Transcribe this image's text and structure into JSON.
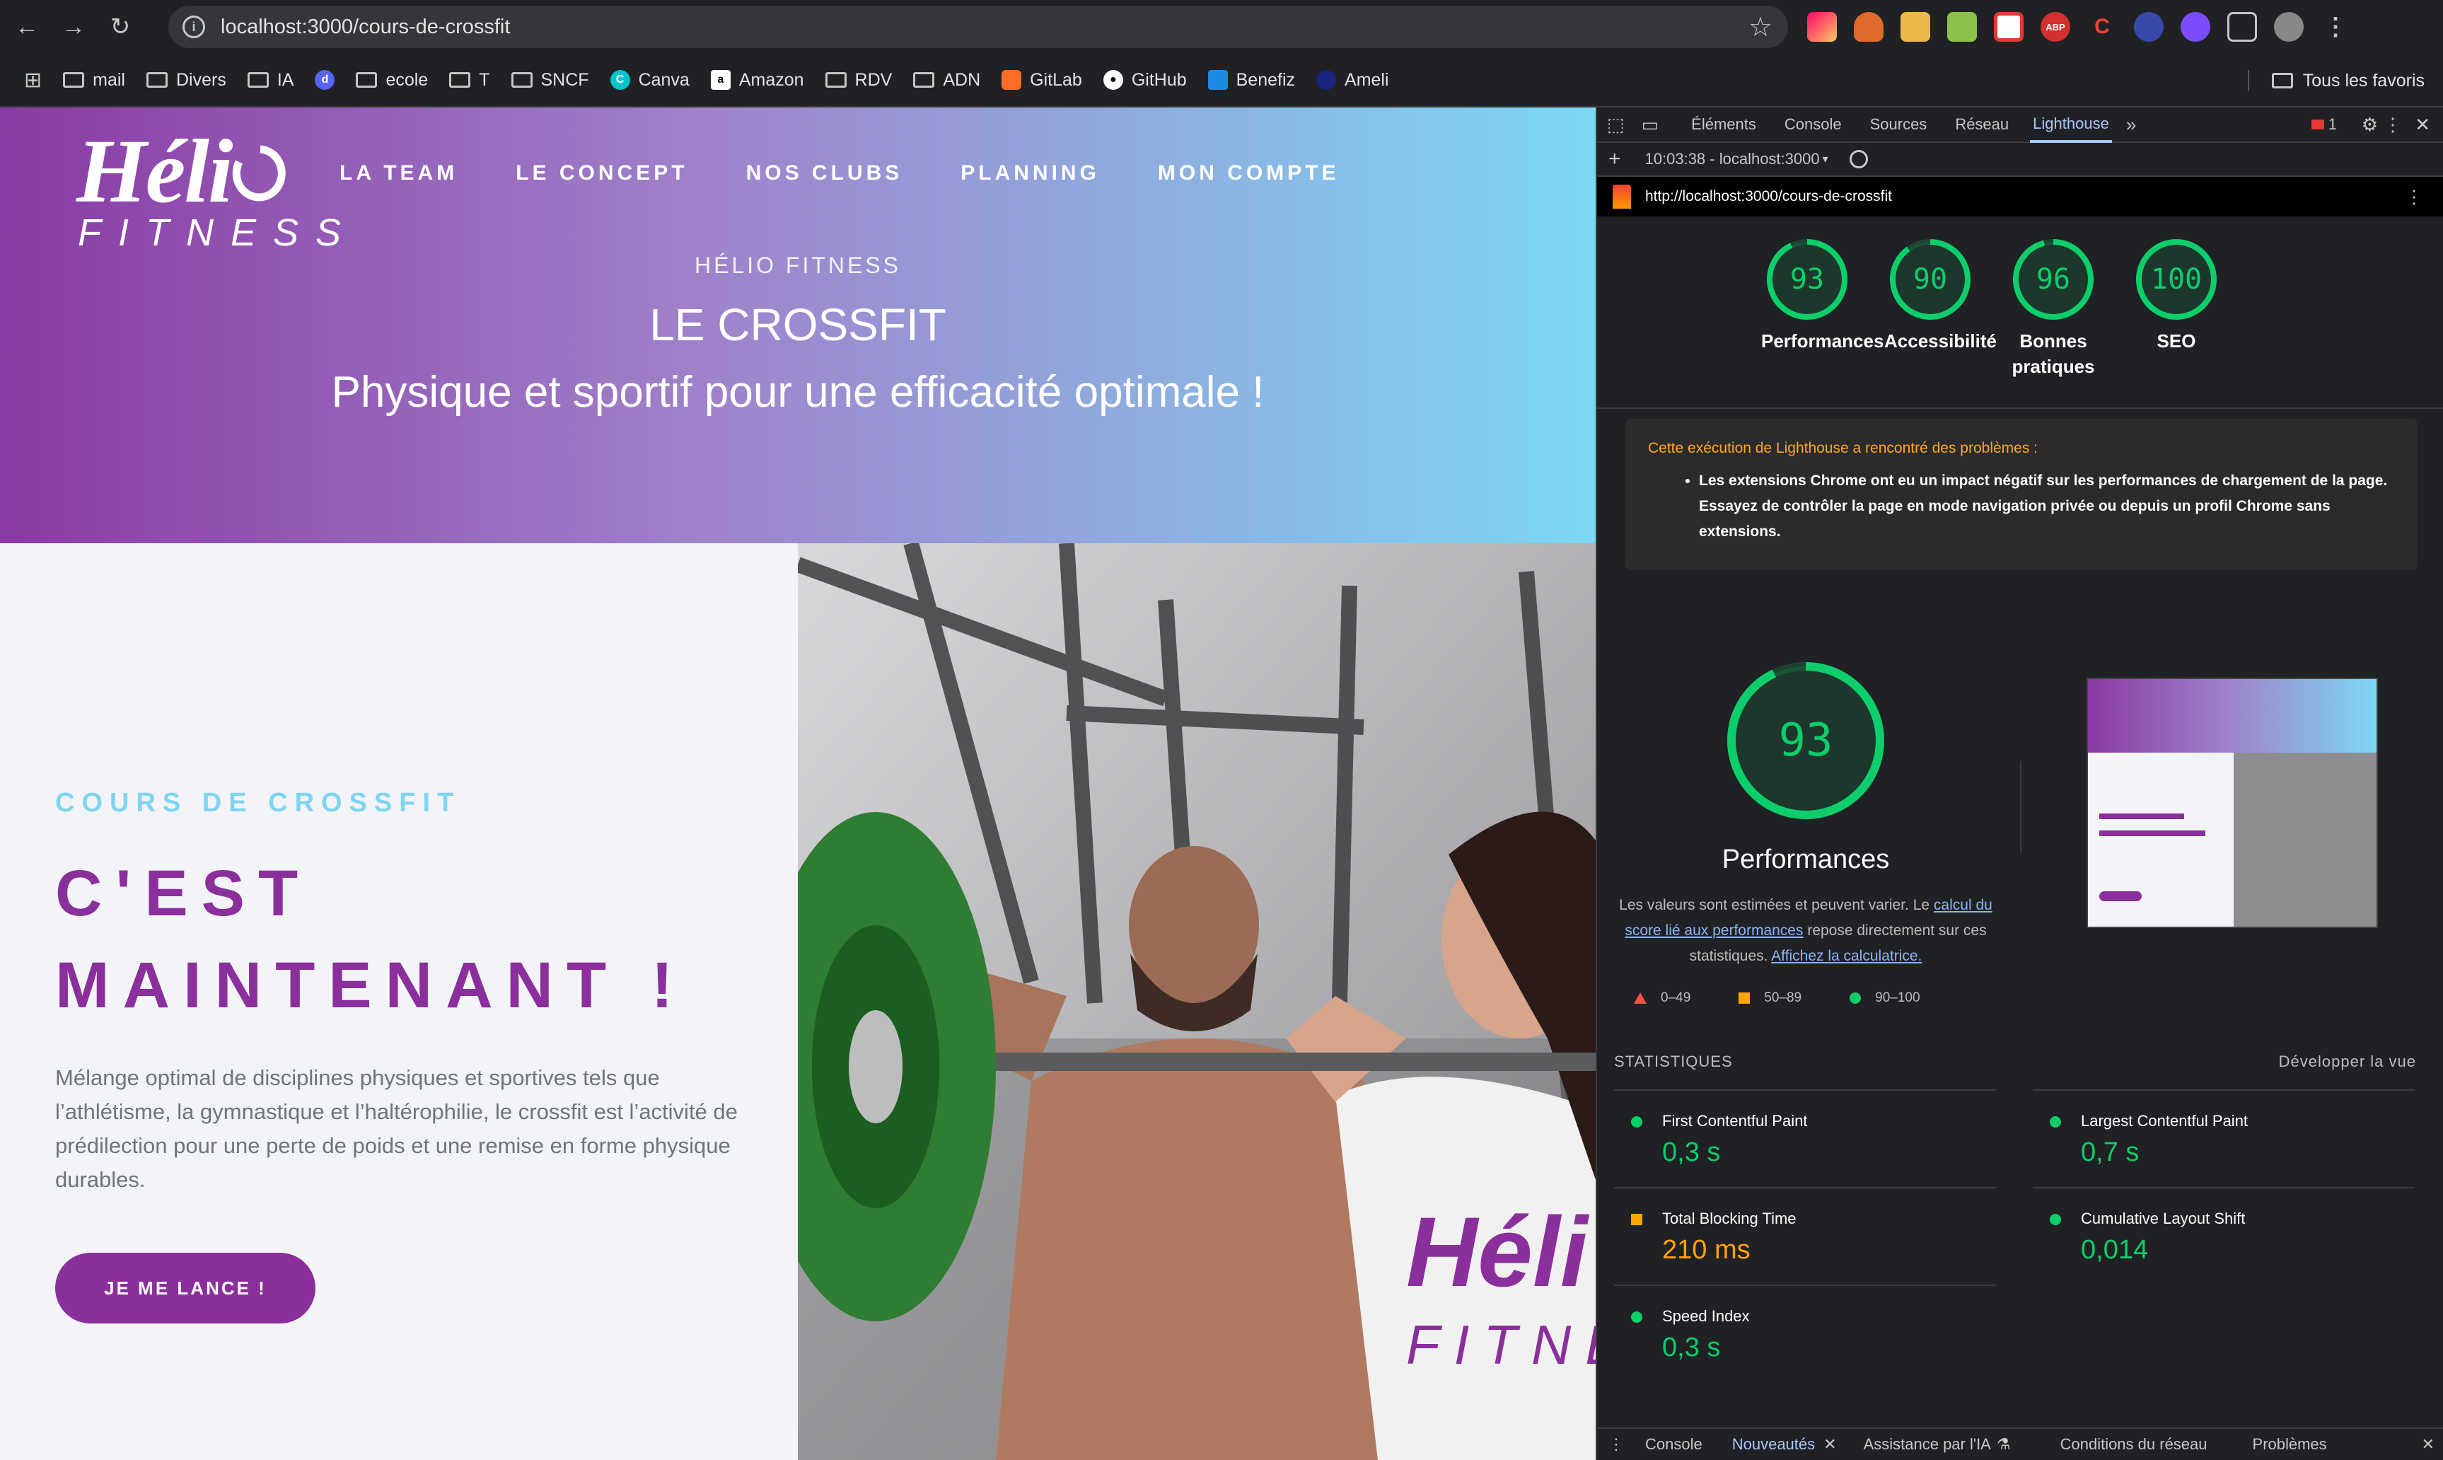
{
  "browser": {
    "url": "localhost:3000/cours-de-crossfit",
    "bookmarks": [
      "mail",
      "Divers",
      "IA",
      "ecole",
      "T",
      "SNCF",
      "Canva",
      "Amazon",
      "RDV",
      "ADN",
      "GitLab",
      "GitHub",
      "Benefiz",
      "Ameli"
    ],
    "all_favorites": "Tous les favoris"
  },
  "site": {
    "logo_top": "Héli",
    "logo_bottom": "FITNESS",
    "nav": [
      "LA TEAM",
      "LE CONCEPT",
      "NOS CLUBS",
      "PLANNING",
      "MON COMPTE"
    ],
    "kicker": "HÉLIO FITNESS",
    "title": "LE CROSSFIT",
    "subtitle": "Physique et sportif pour une efficacité optimale !",
    "eyebrow": "COURS DE CROSSFIT",
    "headline": "C'EST MAINTENANT !",
    "paragraph": "Mélange optimal de disciplines physiques et sportives tels que l’athlétisme, la gymnastique et l’haltérophilie, le crossfit est l’activité de prédilection pour une perte de poids et une remise en forme physique durables.",
    "cta": "JE ME LANCE !",
    "photo_shirt_text": "Héli",
    "photo_shirt_text2": "FITNE"
  },
  "devtools": {
    "tabs": [
      "Éléments",
      "Console",
      "Sources",
      "Réseau",
      "Lighthouse"
    ],
    "active_tab": "Lighthouse",
    "issues_count": "1",
    "report_time": "10:03:38 - localhost:3000",
    "report_url": "http://localhost:3000/cours-de-crossfit",
    "scores": [
      {
        "label": "Performances",
        "value": 93
      },
      {
        "label": "Accessibilité",
        "value": 90
      },
      {
        "label": "Bonnes pratiques",
        "value": 96
      },
      {
        "label": "SEO",
        "value": 100
      }
    ],
    "warning_title": "Cette exécution de Lighthouse a rencontré des problèmes :",
    "warning_item": "Les extensions Chrome ont eu un impact négatif sur les performances de chargement de la page. Essayez de contrôler la page en mode navigation privée ou depuis un profil Chrome sans extensions.",
    "perf_score": 93,
    "perf_title": "Performances",
    "perf_desc_1": "Les valeurs sont estimées et peuvent varier. Le ",
    "perf_desc_link1": "calcul du score lié aux performances",
    "perf_desc_2": " repose directement sur ces statistiques. ",
    "perf_desc_link2": "Affichez la calculatrice.",
    "legend": [
      "0–49",
      "50–89",
      "90–100"
    ],
    "stats_title": "STATISTIQUES",
    "expand": "Développer la vue",
    "metrics": [
      {
        "name": "First Contentful Paint",
        "value": "0,3 s",
        "status": "good"
      },
      {
        "name": "Largest Contentful Paint",
        "value": "0,7 s",
        "status": "good"
      },
      {
        "name": "Total Blocking Time",
        "value": "210 ms",
        "status": "average"
      },
      {
        "name": "Cumulative Layout Shift",
        "value": "0,014",
        "status": "good"
      },
      {
        "name": "Speed Index",
        "value": "0,3 s",
        "status": "good"
      }
    ],
    "bottom_tabs": [
      "Console",
      "Nouveautés",
      "Assistance par l'IA",
      "Conditions du réseau",
      "Problèmes"
    ],
    "colors": {
      "good": "#0cce6b",
      "average": "#ffa400",
      "poor": "#ff4e42"
    }
  }
}
